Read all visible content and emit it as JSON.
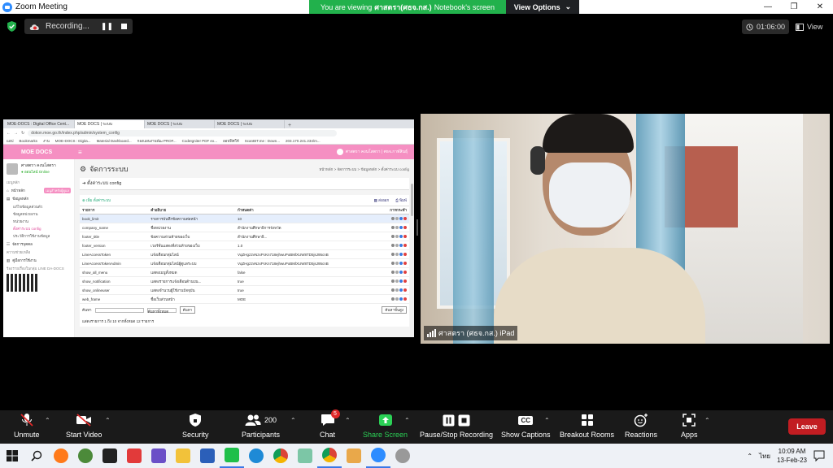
{
  "window": {
    "title": "Zoom Meeting",
    "controls": [
      "—",
      "❐",
      "✕"
    ]
  },
  "banner": {
    "prefix": "You are viewing",
    "presenter": "ศาสตรา(ศธจ.กส.)",
    "suffix": "Notebook's screen",
    "view_options": "View Options"
  },
  "recording": {
    "label": "Recording...",
    "pause_glyph": "❚❚"
  },
  "timer": "01:06:00",
  "view_label": "View",
  "browser": {
    "tabs": [
      "MOE-DOCS : Digital Office Cent...",
      "MOE DOCS | ระบบ",
      "MOE DOCS | ระบบ",
      "MOE DOCS | ระบบ"
    ],
    "url": "dokon.moe.go.th/index.php/admin/system_config",
    "bookmarks": [
      "แอป",
      "Bookmarks",
      "งาน",
      "MOE-DOCS : Digita...",
      "Material Dashboard...",
      "กองแผนงานพัฒ PROF...",
      "CodeIgniter PDF ex...",
      "ออฟฟิศให้",
      "ScanBIT.me : Down...",
      "203.170.241.234/m..."
    ]
  },
  "app": {
    "brand": "MOE DOCS",
    "menu_glyph": "≡",
    "header_user": "ศาสตรา คงนโสตรา | ศธจ.กาฬสินธุ์",
    "sidebar": {
      "user_name": "ศาสตรา คงนโสตรา",
      "user_status": "● ออนไลน์ Online",
      "section1": "เมนูหลัก",
      "home": "หน้าหลัก",
      "home_badge": "เมนูสำหรับผู้ดูแล",
      "basic_data": "ข้อมูลหลัก",
      "sub_items": [
        "แก้ไขข้อมูลส่วนตัว",
        "ข้อมูลหน่วยงาน",
        "หน่วยงาน",
        "ตั้งค่าระบบ config",
        "ประวัติการใช้งานข้อมูล"
      ],
      "manage": "จัดการบุคคล",
      "section2": "ความช่วยเหลือ",
      "manual": "คู่มือการใช้งาน",
      "line_group": "ร้องรายเรื่องในกลุ่ม LINE DA-DOCS"
    },
    "page_title": "จัดการระบบ",
    "crumbs": [
      "หน้าหลัก",
      "จัดการระบบ",
      "ข้อมูลหลัก",
      "ตั้งค่าระบบ config"
    ],
    "panel_title": "ตั้งค่าระบบ config",
    "add_label": "เพิ่ม ตั้งค่าระบบ",
    "export_label": "ส่งออก",
    "print_label": "พิมพ์",
    "columns": [
      "รายการ",
      "คำอธิบาย",
      "กำหนดค่า",
      "การกระทำ"
    ],
    "rows": [
      {
        "key": "book_limit",
        "desc": "รายการบันทึกข้อความต่อหน้า",
        "value": "10"
      },
      {
        "key": "company_name",
        "desc": "ชื่อหน่วยงาน",
        "value": "สำนักงานศึกษาธิการจังหวัด"
      },
      {
        "key": "footer_title",
        "desc": "ข้อความส่วนท้ายของเว็บ",
        "value": "สำนักงานศึกษาธิ..."
      },
      {
        "key": "footer_version",
        "desc": "เวอร์ชั่นแสดงที่ส่วนท้ายของเว็บ",
        "value": "1.0"
      },
      {
        "key": "LineAccessToken",
        "desc": "แจ้งเตือนกลุ่มไลน์",
        "value": "VqZHgz2vNzxPcKn718ejhwuPoBMlXUW8TD5jsJ95cnB"
      },
      {
        "key": "LineAccessTokenAdmin",
        "desc": "แจ้งเตือนกลุ่มไลน์ผู้ดูแลระบบ",
        "value": "VqZHgz2vNzxPcKn718ejhwuPoBMlXUW8TD5jsJ95cnB"
      },
      {
        "key": "show_all_menu",
        "desc": "แสดงเมนูทั้งหมด",
        "value": "false"
      },
      {
        "key": "show_notification",
        "desc": "แสดงรายการแจ้งเตือนด้านบน...",
        "value": "true"
      },
      {
        "key": "show_onlineuser",
        "desc": "แสดงจำนวนผู้ใช้งานปัจจุบัน",
        "value": "true"
      },
      {
        "key": "web_frame",
        "desc": "ชื่อเว็บส่วนหน้า",
        "value": "MOE"
      }
    ],
    "search_label": "ค้นหา",
    "search_btn": "ค้นหา",
    "filter_select": "ค้นหาทั้งหมด",
    "advanced_btn": "ค้นหาขั้นสูง",
    "footer_text": "แสดงรายการ 1 ถึง 10 จากทั้งหมด 12 รายการ"
  },
  "video": {
    "participant_name": "ศาสตรา (ศธจ.กส.) iPad"
  },
  "toolbar": {
    "unmute": "Unmute",
    "start_video": "Start Video",
    "security": "Security",
    "participants": "Participants",
    "participants_count": "200",
    "chat": "Chat",
    "chat_badge": "5",
    "share_screen": "Share Screen",
    "recording": "Pause/Stop Recording",
    "captions": "Show Captions",
    "captions_icon": "CC",
    "breakout": "Breakout Rooms",
    "reactions": "Reactions",
    "apps": "Apps",
    "leave": "Leave",
    "share_color": "#2bd156"
  },
  "taskbar": {
    "lang": "ไทย",
    "time": "10:09 AM",
    "date": "13-Feb-23"
  }
}
